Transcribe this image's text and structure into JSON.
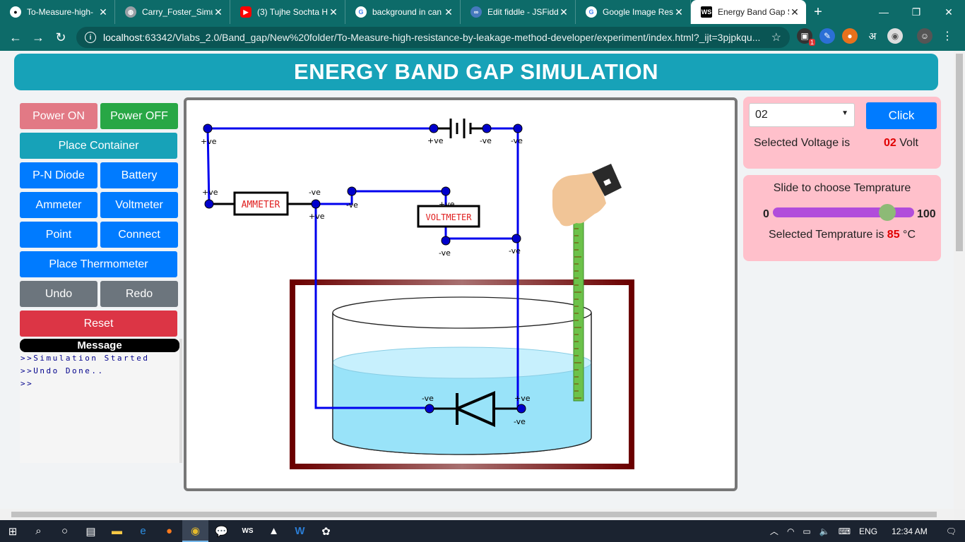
{
  "browser": {
    "tabs": [
      {
        "title": "To-Measure-high-",
        "icon": "github-icon",
        "color": "#000000"
      },
      {
        "title": "Carry_Foster_Simu",
        "icon": "globe-icon",
        "color": "#5f6368"
      },
      {
        "title": "(3) Tujhe Sochta H",
        "icon": "youtube-icon",
        "color": "#ff0000"
      },
      {
        "title": "background in can",
        "icon": "google-icon",
        "color": "#ffffff"
      },
      {
        "title": "Edit fiddle - JSFidd",
        "icon": "jsfiddle-icon",
        "color": "#4679bd"
      },
      {
        "title": "Google Image Res",
        "icon": "google-icon",
        "color": "#ffffff"
      },
      {
        "title": "Energy Band Gap S",
        "icon": "webstorm-icon",
        "color": "#000000"
      }
    ],
    "url_host": "localhost",
    "url_rest": ":63342/Vlabs_2.0/Band_gap/New%20folder/To-Measure-high-resistance-by-leakage-method-developer/experiment/index.html?_ijt=3pjpkqu...",
    "ext_badge": "1",
    "ext_hindi": "अ"
  },
  "header": {
    "title": "ENERGY BAND GAP SIMULATION"
  },
  "controls": {
    "power_on": "Power ON",
    "power_off": "Power OFF",
    "place_container": "Place Container",
    "pn_diode": "P-N Diode",
    "battery": "Battery",
    "ammeter": "Ammeter",
    "voltmeter": "Voltmeter",
    "point": "Point",
    "connect": "Connect",
    "place_thermometer": "Place Thermometer",
    "undo": "Undo",
    "redo": "Redo",
    "reset": "Reset"
  },
  "message": {
    "title": "Message",
    "lines": [
      ">>Simulation Started",
      ">>Undo Done..",
      ">>"
    ]
  },
  "circuit": {
    "ammeter_label": "AMMETER",
    "voltmeter_label": "VOLTMETER",
    "pos": "+ve",
    "neg": "-ve"
  },
  "voltage_panel": {
    "selected": "02",
    "click_label": "Click",
    "label": "Selected Voltage is",
    "value": "02",
    "unit": "Volt"
  },
  "temp_panel": {
    "title": "Slide to choose Temprature",
    "min": "0",
    "max": "100",
    "value_fraction": 0.85,
    "label": "Selected Temprature is",
    "value": "85",
    "unit": "°C"
  },
  "taskbar": {
    "lang": "ENG",
    "time": "12:34 AM"
  }
}
